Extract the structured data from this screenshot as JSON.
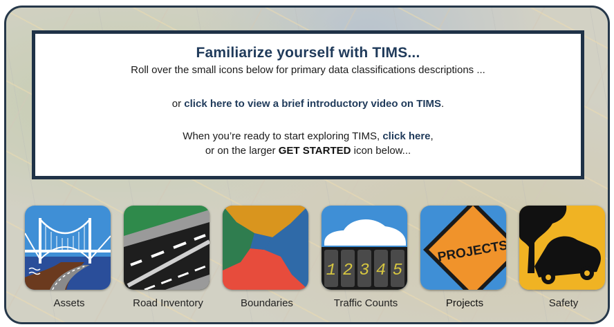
{
  "info": {
    "title": "Familiarize yourself with TIMS...",
    "line1": "Roll over the small icons below for primary data classifications descriptions ...",
    "line2_prefix": "or ",
    "line2_link": "click here to view a brief introductory video on TIMS",
    "line2_suffix": ".",
    "line3_prefix": "When you’re ready to start exploring TIMS, ",
    "line3_link": "click here",
    "line3_suffix": ",",
    "line4_prefix": "or on the larger ",
    "line4_strong": "GET STARTED",
    "line4_suffix": " icon below..."
  },
  "tiles": [
    {
      "label": "Assets",
      "icon": "bridge-icon"
    },
    {
      "label": "Road Inventory",
      "icon": "road-icon"
    },
    {
      "label": "Boundaries",
      "icon": "boundaries-icon"
    },
    {
      "label": "Traffic Counts",
      "icon": "traffic-counter-icon",
      "digits": "12345"
    },
    {
      "label": "Projects",
      "icon": "projects-sign-icon",
      "sign_text": "PROJECTS"
    },
    {
      "label": "Safety",
      "icon": "car-crash-icon"
    }
  ],
  "colors": {
    "frame": "#26384a",
    "title": "#1f3a5a",
    "assets_sky": "#3f8fd6",
    "boundaries_yellow": "#d9951e",
    "boundaries_red": "#e74c3c",
    "boundaries_green": "#2f7d4f",
    "boundaries_blue": "#2f6aa8",
    "traffic_digits": "#d6c640",
    "projects_orange": "#f0932b",
    "safety_yellow": "#f0b323"
  }
}
